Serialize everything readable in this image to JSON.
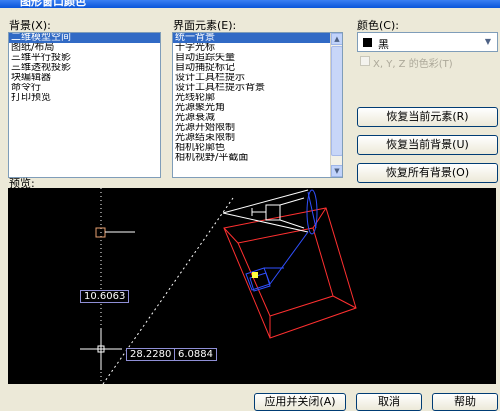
{
  "window": {
    "title": "图形窗口颜色"
  },
  "background": {
    "label": "背景(X):",
    "items": [
      "二维模型空间",
      "图纸/布局",
      "三维平行投影",
      "三维透视投影",
      "块编辑器",
      "命令行",
      "打印预览"
    ],
    "selected_index": 0
  },
  "elements": {
    "label": "界面元素(E):",
    "items": [
      "统一背景",
      "十字光标",
      "自动追踪矢量",
      "自动捕捉标记",
      "设计工具栏提示",
      "设计工具栏提示背景",
      "光线轮廓",
      "光源聚光角",
      "光源衰减",
      "光源开始限制",
      "光源结束限制",
      "相机轮廓色",
      "相机视野/平截面"
    ],
    "selected_index": 0
  },
  "color": {
    "label": "颜色(C):",
    "value": "黑",
    "swatch": "#000000",
    "tint_label": "X, Y, Z 的色彩(T)"
  },
  "buttons": {
    "restore_element": "恢复当前元素(R)",
    "restore_context": "恢复当前背景(U)",
    "restore_all": "恢复所有背景(O)",
    "apply_close": "应用并关闭(A)",
    "cancel": "取消",
    "help": "帮助"
  },
  "preview": {
    "label": "预览:",
    "dim_vertical": "10.6063",
    "coord_x": "28.2280",
    "coord_y": "6.0884"
  },
  "colors": {
    "selection": "#316ac5",
    "preview_bg": "#000000",
    "red": "#ff3030",
    "blue": "#3050ff",
    "yellow": "#ffff40",
    "accent": "#0a55d9"
  }
}
